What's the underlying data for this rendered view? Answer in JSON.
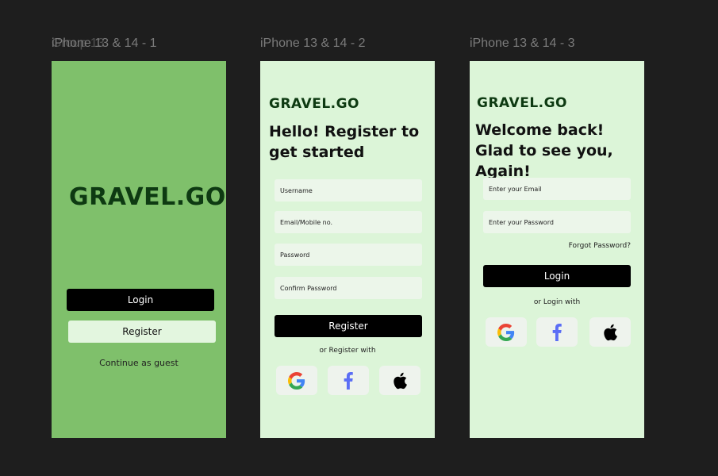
{
  "frames": [
    {
      "label": "iPhone 13 & 14 - 1",
      "label_overlay": "Group 13",
      "logo": "GRAVEL.GO",
      "login_button": "Login",
      "register_button": "Register",
      "guest_link": "Continue as guest"
    },
    {
      "label": "iPhone 13 & 14 - 2",
      "logo": "GRAVEL.GO",
      "heading": "Hello! Register to get started",
      "fields": [
        "Username",
        "Email/Mobile no.",
        "Password",
        "Confirm Password"
      ],
      "register_button": "Register",
      "alt_text": "or Register with",
      "social": [
        "google-icon",
        "facebook-icon",
        "apple-icon"
      ]
    },
    {
      "label": "iPhone 13 & 14 - 3",
      "logo": "GRAVEL.GO",
      "heading": "Welcome back! Glad to see you, Again!",
      "fields": [
        "Enter your Email",
        "Enter your Password"
      ],
      "forgot_link": "Forgot Password?",
      "login_button": "Login",
      "alt_text": "or Login with",
      "social": [
        "google-icon",
        "facebook-icon",
        "apple-icon"
      ]
    }
  ],
  "colors": {
    "canvas": "#1e1e1e",
    "splash_bg": "#7fc06b",
    "screen_bg": "#dcf5d8",
    "logo": "#0e3a12",
    "facebook": "#5b6ef5"
  }
}
